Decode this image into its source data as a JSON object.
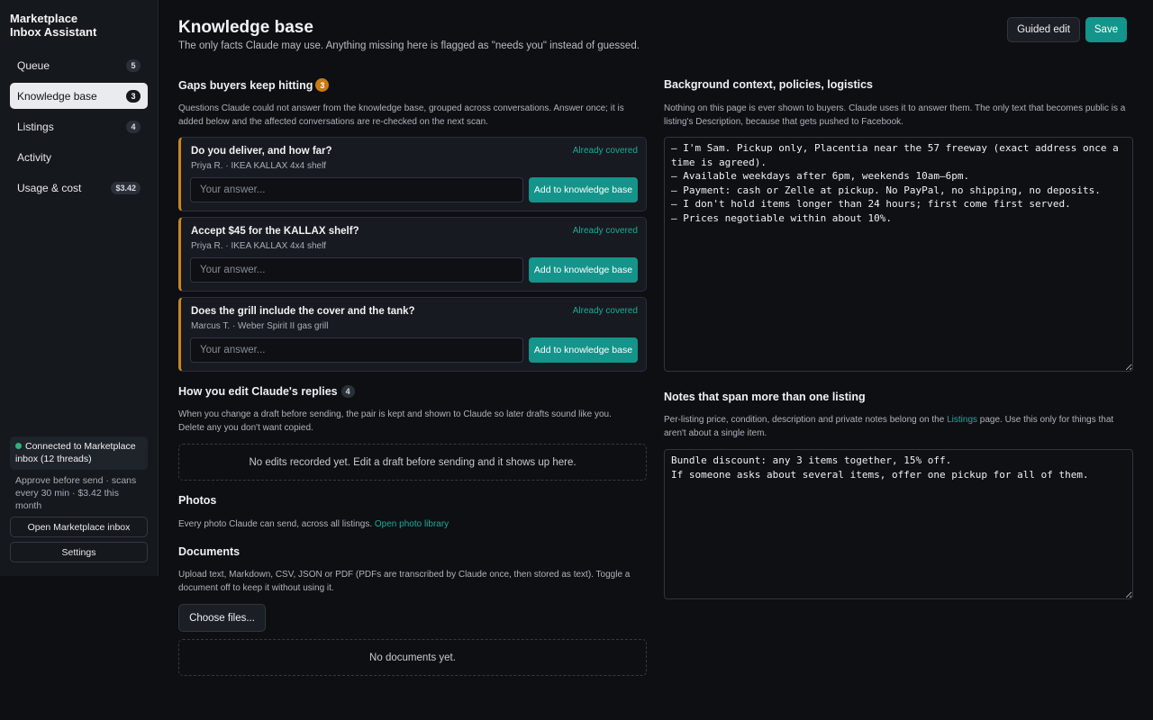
{
  "app": {
    "title_line1": "Marketplace",
    "title_line2": "Inbox Assistant"
  },
  "sidebar": {
    "items": [
      {
        "label": "Queue",
        "badge": "5"
      },
      {
        "label": "Knowledge base",
        "badge": "3"
      },
      {
        "label": "Listings",
        "badge": "4"
      },
      {
        "label": "Activity",
        "badge": ""
      },
      {
        "label": "Usage & cost",
        "badge": "$3.42"
      }
    ],
    "connection": "Connected to Marketplace inbox (12 threads)",
    "meta": "Approve before send · scans every 30 min · $3.42 this month",
    "open_inbox": "Open Marketplace inbox",
    "settings": "Settings"
  },
  "header": {
    "title": "Knowledge base",
    "subtitle": "The only facts Claude may use. Anything missing here is flagged as \"needs you\" instead of guessed.",
    "guided_edit": "Guided edit",
    "save": "Save"
  },
  "gaps": {
    "title": "Gaps buyers keep hitting",
    "count": "3",
    "desc": "Questions Claude could not answer from the knowledge base, grouped across conversations. Answer once; it is added below and the affected conversations are re-checked on the next scan.",
    "placeholder": "Your answer...",
    "add_label": "Add to knowledge base",
    "covered_label": "Already covered",
    "items": [
      {
        "question": "Do you deliver, and how far?",
        "meta": "Priya R. · IKEA KALLAX 4x4 shelf"
      },
      {
        "question": "Accept $45 for the KALLAX shelf?",
        "meta": "Priya R. · IKEA KALLAX 4x4 shelf"
      },
      {
        "question": "Does the grill include the cover and the tank?",
        "meta": "Marcus T. · Weber Spirit II gas grill"
      }
    ]
  },
  "edits": {
    "title": "How you edit Claude's replies",
    "count": "4",
    "desc": "When you change a draft before sending, the pair is kept and shown to Claude so later drafts sound like you. Delete any you don't want copied.",
    "empty": "No edits recorded yet. Edit a draft before sending and it shows up here."
  },
  "photos": {
    "title": "Photos",
    "desc": "Every photo Claude can send, across all listings.",
    "link": "Open photo library"
  },
  "documents": {
    "title": "Documents",
    "desc": "Upload text, Markdown, CSV, JSON or PDF (PDFs are transcribed by Claude once, then stored as text). Toggle a document off to keep it without using it.",
    "choose": "Choose files...",
    "empty": "No documents yet."
  },
  "background": {
    "title": "Background context, policies, logistics",
    "desc": "Nothing on this page is ever shown to buyers. Claude uses it to answer them. The only text that becomes public is a listing's Description, because that gets pushed to Facebook.",
    "text": "– I'm Sam. Pickup only, Placentia near the 57 freeway (exact address once a time is agreed).\n– Available weekdays after 6pm, weekends 10am–6pm.\n– Payment: cash or Zelle at pickup. No PayPal, no shipping, no deposits.\n– I don't hold items longer than 24 hours; first come first served.\n– Prices negotiable within about 10%."
  },
  "notes": {
    "title": "Notes that span more than one listing",
    "desc_before": "Per-listing price, condition, description and private notes belong on the",
    "desc_link": "Listings",
    "desc_after": "page. Use this only for things that aren't about a single item.",
    "text": "Bundle discount: any 3 items together, 15% off.\nIf someone asks about several items, offer one pickup for all of them."
  },
  "colors": {
    "accent": "#14948a",
    "warning": "#c97a13",
    "link": "#21a99a"
  }
}
